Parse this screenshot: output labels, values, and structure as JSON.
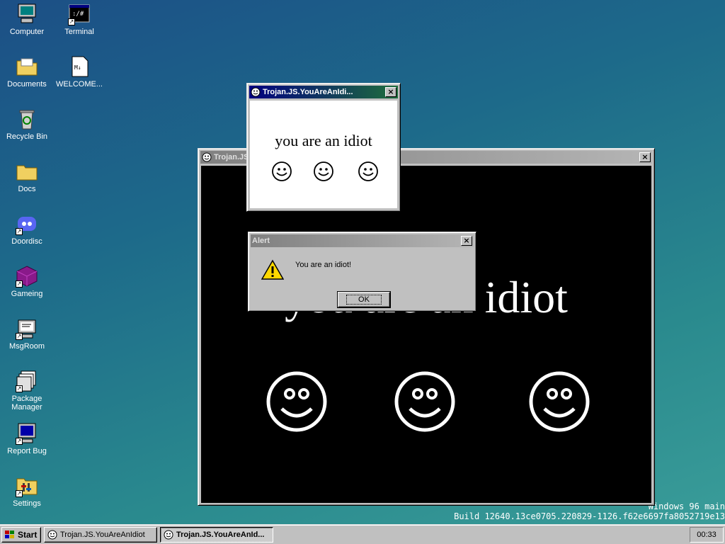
{
  "desktop": {
    "icons": [
      {
        "label": "Computer",
        "icon": "computer-icon"
      },
      {
        "label": "Terminal",
        "icon": "terminal-icon"
      },
      {
        "label": "Documents",
        "icon": "documents-folder-icon"
      },
      {
        "label": "WELCOME...",
        "icon": "markdown-file-icon"
      },
      {
        "label": "Recycle Bin",
        "icon": "recycle-bin-icon"
      },
      {
        "label": "Docs",
        "icon": "folder-icon"
      },
      {
        "label": "Doordisc",
        "icon": "doordisc-icon"
      },
      {
        "label": "Gameing",
        "icon": "gameing-cube-icon"
      },
      {
        "label": "MsgRoom",
        "icon": "msgroom-icon"
      },
      {
        "label": "Package Manager",
        "icon": "package-manager-icon"
      },
      {
        "label": "Report Bug",
        "icon": "report-bug-icon"
      },
      {
        "label": "Settings",
        "icon": "settings-icon"
      }
    ],
    "build_line1": "Windows 96 main",
    "build_line2": "Build 12640.13ce0705.220829-1126.f62e6697fa8052719e13"
  },
  "big_window": {
    "title": "Trojan.JS",
    "message": "you are an idiot",
    "close_label": "×"
  },
  "small_window": {
    "title": "Trojan.JS.YouAreAnIdi...",
    "message": "you are an idiot",
    "close_label": "×"
  },
  "alert": {
    "title": "Alert",
    "message": "You are an idiot!",
    "ok_label": "OK",
    "close_label": "×"
  },
  "taskbar": {
    "start_label": "Start",
    "tasks": [
      {
        "label": "Trojan.JS.YouAreAnIdiot",
        "active": false
      },
      {
        "label": "Trojan.JS.YouAreAnId...",
        "active": true
      }
    ],
    "clock": "00:33"
  },
  "colors": {
    "active_title": "#000080",
    "inactive_title": "#808080",
    "window_face": "#c0c0c0"
  }
}
